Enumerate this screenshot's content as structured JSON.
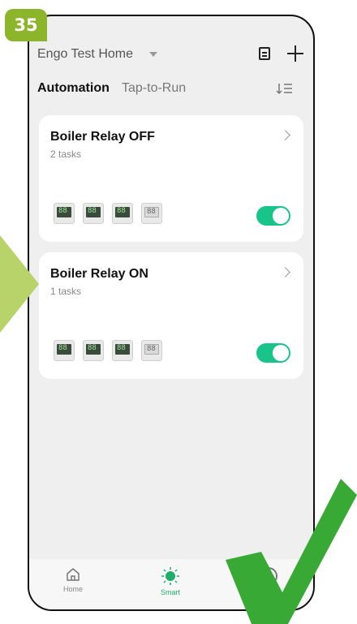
{
  "step": "35",
  "header": {
    "home_name": "Engo Test Home"
  },
  "tabs": {
    "active": "Automation",
    "other": "Tap-to-Run"
  },
  "cards": [
    {
      "title": "Boiler Relay OFF",
      "tasks": "2 tasks",
      "enabled": true
    },
    {
      "title": "Boiler Relay ON",
      "tasks": "1 tasks",
      "enabled": true
    }
  ],
  "nav": {
    "home": "Home",
    "smart": "Smart"
  },
  "colors": {
    "accent_green": "#19c48a",
    "badge_green": "#8db52c",
    "check_green": "#39a935"
  }
}
